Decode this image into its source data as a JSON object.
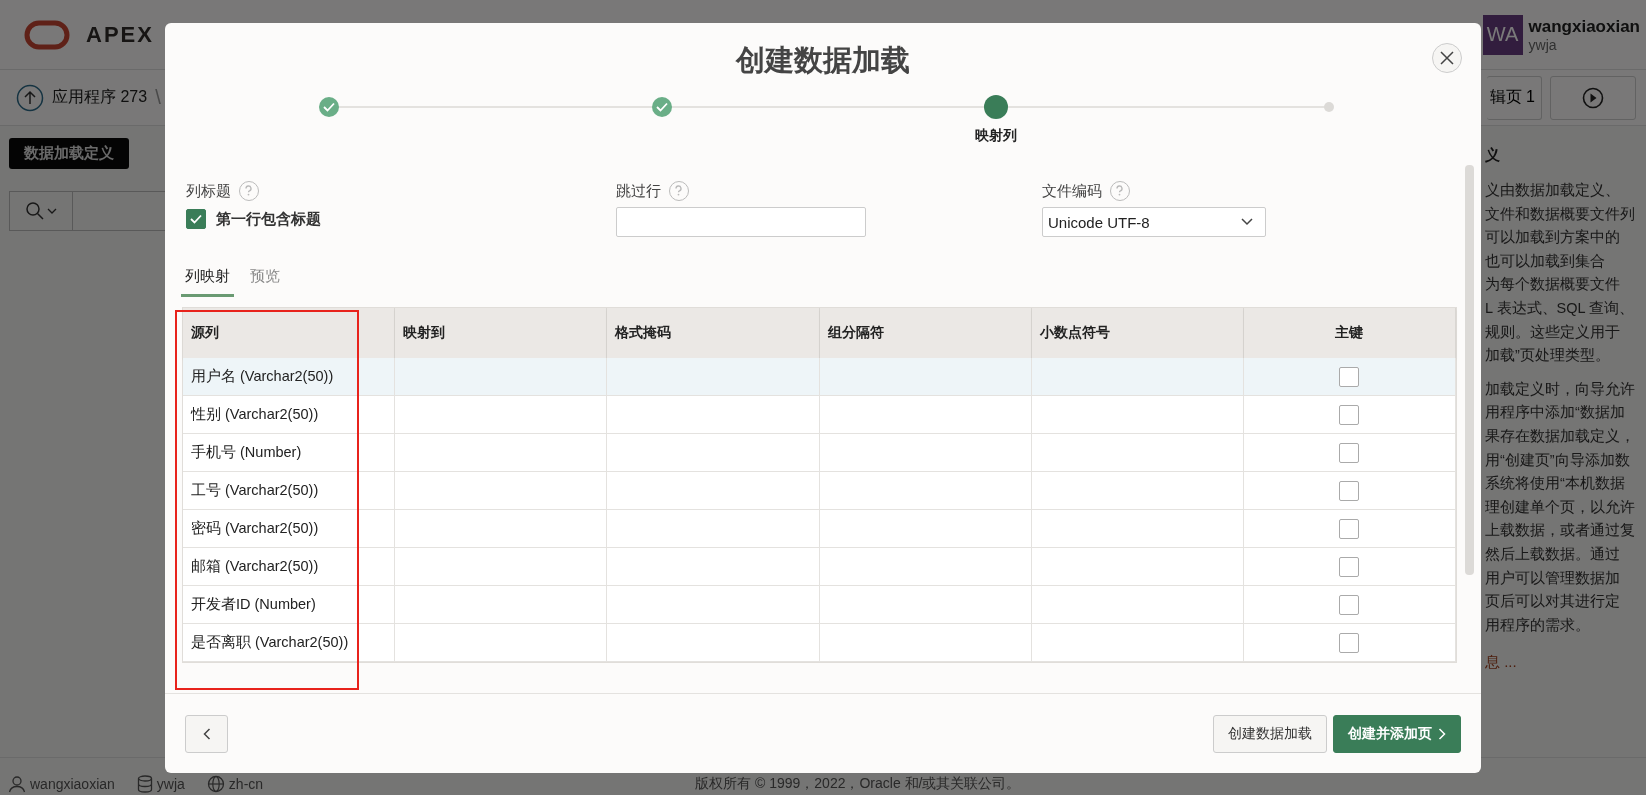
{
  "app_header": {
    "logo": "APEX",
    "user": {
      "initials": "WA",
      "name": "wangxiaoxian",
      "workspace": "ywja"
    }
  },
  "breadcrumb": {
    "label": "应用程序 273",
    "separator": "\\"
  },
  "page_actions": [
    {
      "kind": "text",
      "label": "辑页 1"
    },
    {
      "kind": "run"
    }
  ],
  "definition_button": "数据加载定义",
  "help_panel": {
    "title": "义",
    "paragraphs": [
      [
        "义由数据加载定义、",
        "文件和数据概要文件列",
        "可以加载到方案中的",
        "也可以加载到集合",
        "为每个数据概要文件",
        "L 表达式、SQL 查询、",
        "规则。这些定义用于",
        "加载”页处理类型。"
      ],
      [
        "加载定义时，向导允许",
        "用程序中添加“数据加",
        "果存在数据加载定义，",
        "用“创建页”向导添加数",
        "系统将使用“本机数据",
        "理创建单个页，以允许",
        "上载数据，或者通过复",
        "然后上载数据。通过",
        "用户可以管理数据加",
        "页后可以对其进行定",
        "用程序的需求。"
      ]
    ],
    "more_link": "息 ..."
  },
  "footer": {
    "user": "wangxiaoxian",
    "workspace": "ywja",
    "language": "zh-cn",
    "copyright": "版权所有 © 1999，2022，Oracle 和/或其关联公司。"
  },
  "dialog": {
    "title": "创建数据加载",
    "steps": [
      {
        "completed": true,
        "current": false
      },
      {
        "completed": true,
        "current": false
      },
      {
        "completed": false,
        "current": true,
        "label": "映射列"
      },
      {
        "completed": false,
        "current": false
      }
    ],
    "options": [
      {
        "kind": "checkbox",
        "label": "列标题",
        "checkbox_label": "第一行包含标题",
        "checked": true
      },
      {
        "kind": "text",
        "label": "跳过行"
      },
      {
        "kind": "select",
        "label": "文件编码",
        "value": "Unicode UTF-8"
      }
    ],
    "tabs": [
      {
        "label": "列映射",
        "selected": true
      },
      {
        "label": "预览",
        "selected": false
      }
    ],
    "table": {
      "columns": [
        {
          "label": "源列",
          "highlighted": true
        },
        {
          "label": "映射到",
          "highlighted": false
        },
        {
          "label": "格式掩码",
          "highlighted": false
        },
        {
          "label": "组分隔符",
          "highlighted": false
        },
        {
          "label": "小数点符号",
          "highlighted": false
        },
        {
          "label": "主键",
          "highlighted": false
        }
      ],
      "rows": [
        {
          "source": "用户名 (Varchar2(50))",
          "primary_key": false,
          "selected": true
        },
        {
          "source": "性别 (Varchar2(50))",
          "primary_key": false,
          "selected": false
        },
        {
          "source": "手机号 (Number)",
          "primary_key": false,
          "selected": false
        },
        {
          "source": "工号 (Varchar2(50))",
          "primary_key": false,
          "selected": false
        },
        {
          "source": "密码 (Varchar2(50))",
          "primary_key": false,
          "selected": false
        },
        {
          "source": "邮箱 (Varchar2(50))",
          "primary_key": false,
          "selected": false
        },
        {
          "source": "开发者ID (Number)",
          "primary_key": false,
          "selected": false
        },
        {
          "source": "是否离职 (Varchar2(50))",
          "primary_key": false,
          "selected": false
        }
      ]
    },
    "buttons": [
      {
        "kind": "back"
      },
      {
        "kind": "secondary",
        "label": "创建数据加载"
      },
      {
        "kind": "primary",
        "label": "创建并添加页"
      }
    ]
  }
}
